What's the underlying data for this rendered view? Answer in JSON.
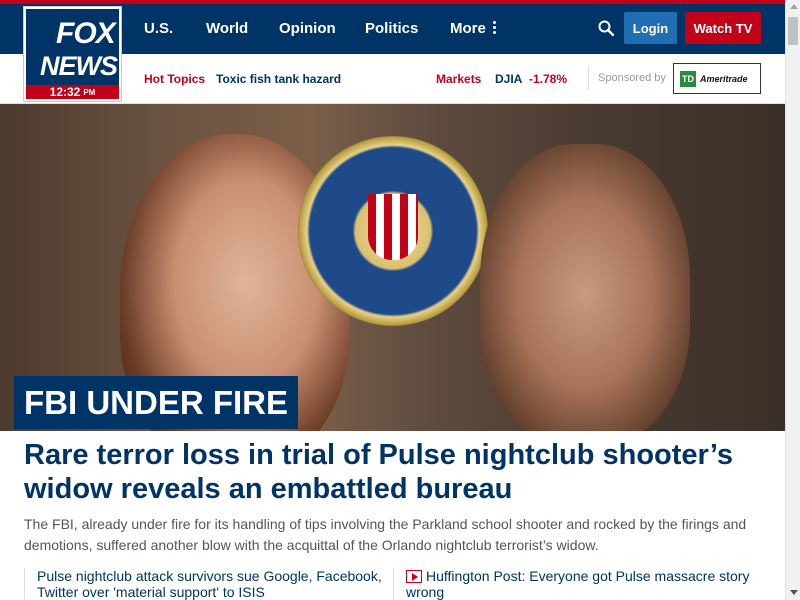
{
  "brand": {
    "logo_top": "FOX",
    "logo_bottom": "NEWS",
    "time": "12:32",
    "ampm": "PM"
  },
  "nav": {
    "items": [
      {
        "label": "U.S."
      },
      {
        "label": "World"
      },
      {
        "label": "Opinion"
      },
      {
        "label": "Politics"
      },
      {
        "label": "More"
      }
    ],
    "login_label": "Login",
    "watch_label": "Watch TV"
  },
  "subbar": {
    "hot_topics_label": "Hot Topics",
    "hot_topic_item": "Toxic fish tank hazard",
    "markets_label": "Markets",
    "djia_label": "DJIA",
    "djia_change": "-1.78%",
    "sponsored_label": "Sponsored by",
    "sponsor_name": "Ameritrade",
    "sponsor_badge": "TD"
  },
  "hero": {
    "tag": "FBI UNDER FIRE",
    "headline": "Rare terror loss in trial of Pulse nightclub shooter’s widow reveals an embattled bureau",
    "summary": "The FBI, already under fire for its handling of tips involving the Parkland school shooter and rocked by the firings and demotions, suffered another blow with the acquittal of the Orlando nightclub terrorist’s widow."
  },
  "related": [
    {
      "text": "Pulse nightclub attack survivors sue Google, Facebook, Twitter over 'material support' to ISIS"
    },
    {
      "text": "Huffington Post: Everyone got Pulse massacre story wrong"
    }
  ],
  "colors": {
    "navy": "#003366",
    "red": "#c20017",
    "link_blue": "#1f6fb2"
  }
}
